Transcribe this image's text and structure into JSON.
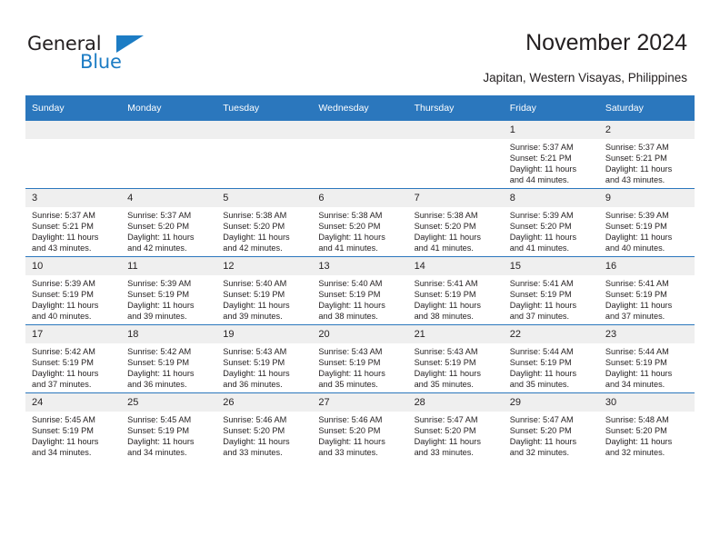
{
  "logo": {
    "word_one": "General",
    "word_two": "Blue",
    "flag_icon": "blue-triangle-flag"
  },
  "header": {
    "title": "November 2024",
    "subtitle": "Japitan, Western Visayas, Philippines"
  },
  "colors": {
    "header_blue": "#2b77bd",
    "daynum_gray": "#efefef",
    "logo_blue": "#1c7cc4",
    "text": "#231f20"
  },
  "calendar": {
    "weekdays": [
      "Sunday",
      "Monday",
      "Tuesday",
      "Wednesday",
      "Thursday",
      "Friday",
      "Saturday"
    ],
    "weeks": [
      [
        {
          "day": "",
          "sunrise": "",
          "sunset": "",
          "daylight_1": "",
          "daylight_2": "",
          "empty": true
        },
        {
          "day": "",
          "sunrise": "",
          "sunset": "",
          "daylight_1": "",
          "daylight_2": "",
          "empty": true
        },
        {
          "day": "",
          "sunrise": "",
          "sunset": "",
          "daylight_1": "",
          "daylight_2": "",
          "empty": true
        },
        {
          "day": "",
          "sunrise": "",
          "sunset": "",
          "daylight_1": "",
          "daylight_2": "",
          "empty": true
        },
        {
          "day": "",
          "sunrise": "",
          "sunset": "",
          "daylight_1": "",
          "daylight_2": "",
          "empty": true
        },
        {
          "day": "1",
          "sunrise": "Sunrise: 5:37 AM",
          "sunset": "Sunset: 5:21 PM",
          "daylight_1": "Daylight: 11 hours",
          "daylight_2": "and 44 minutes.",
          "empty": false
        },
        {
          "day": "2",
          "sunrise": "Sunrise: 5:37 AM",
          "sunset": "Sunset: 5:21 PM",
          "daylight_1": "Daylight: 11 hours",
          "daylight_2": "and 43 minutes.",
          "empty": false
        }
      ],
      [
        {
          "day": "3",
          "sunrise": "Sunrise: 5:37 AM",
          "sunset": "Sunset: 5:21 PM",
          "daylight_1": "Daylight: 11 hours",
          "daylight_2": "and 43 minutes.",
          "empty": false
        },
        {
          "day": "4",
          "sunrise": "Sunrise: 5:37 AM",
          "sunset": "Sunset: 5:20 PM",
          "daylight_1": "Daylight: 11 hours",
          "daylight_2": "and 42 minutes.",
          "empty": false
        },
        {
          "day": "5",
          "sunrise": "Sunrise: 5:38 AM",
          "sunset": "Sunset: 5:20 PM",
          "daylight_1": "Daylight: 11 hours",
          "daylight_2": "and 42 minutes.",
          "empty": false
        },
        {
          "day": "6",
          "sunrise": "Sunrise: 5:38 AM",
          "sunset": "Sunset: 5:20 PM",
          "daylight_1": "Daylight: 11 hours",
          "daylight_2": "and 41 minutes.",
          "empty": false
        },
        {
          "day": "7",
          "sunrise": "Sunrise: 5:38 AM",
          "sunset": "Sunset: 5:20 PM",
          "daylight_1": "Daylight: 11 hours",
          "daylight_2": "and 41 minutes.",
          "empty": false
        },
        {
          "day": "8",
          "sunrise": "Sunrise: 5:39 AM",
          "sunset": "Sunset: 5:20 PM",
          "daylight_1": "Daylight: 11 hours",
          "daylight_2": "and 41 minutes.",
          "empty": false
        },
        {
          "day": "9",
          "sunrise": "Sunrise: 5:39 AM",
          "sunset": "Sunset: 5:19 PM",
          "daylight_1": "Daylight: 11 hours",
          "daylight_2": "and 40 minutes.",
          "empty": false
        }
      ],
      [
        {
          "day": "10",
          "sunrise": "Sunrise: 5:39 AM",
          "sunset": "Sunset: 5:19 PM",
          "daylight_1": "Daylight: 11 hours",
          "daylight_2": "and 40 minutes.",
          "empty": false
        },
        {
          "day": "11",
          "sunrise": "Sunrise: 5:39 AM",
          "sunset": "Sunset: 5:19 PM",
          "daylight_1": "Daylight: 11 hours",
          "daylight_2": "and 39 minutes.",
          "empty": false
        },
        {
          "day": "12",
          "sunrise": "Sunrise: 5:40 AM",
          "sunset": "Sunset: 5:19 PM",
          "daylight_1": "Daylight: 11 hours",
          "daylight_2": "and 39 minutes.",
          "empty": false
        },
        {
          "day": "13",
          "sunrise": "Sunrise: 5:40 AM",
          "sunset": "Sunset: 5:19 PM",
          "daylight_1": "Daylight: 11 hours",
          "daylight_2": "and 38 minutes.",
          "empty": false
        },
        {
          "day": "14",
          "sunrise": "Sunrise: 5:41 AM",
          "sunset": "Sunset: 5:19 PM",
          "daylight_1": "Daylight: 11 hours",
          "daylight_2": "and 38 minutes.",
          "empty": false
        },
        {
          "day": "15",
          "sunrise": "Sunrise: 5:41 AM",
          "sunset": "Sunset: 5:19 PM",
          "daylight_1": "Daylight: 11 hours",
          "daylight_2": "and 37 minutes.",
          "empty": false
        },
        {
          "day": "16",
          "sunrise": "Sunrise: 5:41 AM",
          "sunset": "Sunset: 5:19 PM",
          "daylight_1": "Daylight: 11 hours",
          "daylight_2": "and 37 minutes.",
          "empty": false
        }
      ],
      [
        {
          "day": "17",
          "sunrise": "Sunrise: 5:42 AM",
          "sunset": "Sunset: 5:19 PM",
          "daylight_1": "Daylight: 11 hours",
          "daylight_2": "and 37 minutes.",
          "empty": false
        },
        {
          "day": "18",
          "sunrise": "Sunrise: 5:42 AM",
          "sunset": "Sunset: 5:19 PM",
          "daylight_1": "Daylight: 11 hours",
          "daylight_2": "and 36 minutes.",
          "empty": false
        },
        {
          "day": "19",
          "sunrise": "Sunrise: 5:43 AM",
          "sunset": "Sunset: 5:19 PM",
          "daylight_1": "Daylight: 11 hours",
          "daylight_2": "and 36 minutes.",
          "empty": false
        },
        {
          "day": "20",
          "sunrise": "Sunrise: 5:43 AM",
          "sunset": "Sunset: 5:19 PM",
          "daylight_1": "Daylight: 11 hours",
          "daylight_2": "and 35 minutes.",
          "empty": false
        },
        {
          "day": "21",
          "sunrise": "Sunrise: 5:43 AM",
          "sunset": "Sunset: 5:19 PM",
          "daylight_1": "Daylight: 11 hours",
          "daylight_2": "and 35 minutes.",
          "empty": false
        },
        {
          "day": "22",
          "sunrise": "Sunrise: 5:44 AM",
          "sunset": "Sunset: 5:19 PM",
          "daylight_1": "Daylight: 11 hours",
          "daylight_2": "and 35 minutes.",
          "empty": false
        },
        {
          "day": "23",
          "sunrise": "Sunrise: 5:44 AM",
          "sunset": "Sunset: 5:19 PM",
          "daylight_1": "Daylight: 11 hours",
          "daylight_2": "and 34 minutes.",
          "empty": false
        }
      ],
      [
        {
          "day": "24",
          "sunrise": "Sunrise: 5:45 AM",
          "sunset": "Sunset: 5:19 PM",
          "daylight_1": "Daylight: 11 hours",
          "daylight_2": "and 34 minutes.",
          "empty": false
        },
        {
          "day": "25",
          "sunrise": "Sunrise: 5:45 AM",
          "sunset": "Sunset: 5:19 PM",
          "daylight_1": "Daylight: 11 hours",
          "daylight_2": "and 34 minutes.",
          "empty": false
        },
        {
          "day": "26",
          "sunrise": "Sunrise: 5:46 AM",
          "sunset": "Sunset: 5:20 PM",
          "daylight_1": "Daylight: 11 hours",
          "daylight_2": "and 33 minutes.",
          "empty": false
        },
        {
          "day": "27",
          "sunrise": "Sunrise: 5:46 AM",
          "sunset": "Sunset: 5:20 PM",
          "daylight_1": "Daylight: 11 hours",
          "daylight_2": "and 33 minutes.",
          "empty": false
        },
        {
          "day": "28",
          "sunrise": "Sunrise: 5:47 AM",
          "sunset": "Sunset: 5:20 PM",
          "daylight_1": "Daylight: 11 hours",
          "daylight_2": "and 33 minutes.",
          "empty": false
        },
        {
          "day": "29",
          "sunrise": "Sunrise: 5:47 AM",
          "sunset": "Sunset: 5:20 PM",
          "daylight_1": "Daylight: 11 hours",
          "daylight_2": "and 32 minutes.",
          "empty": false
        },
        {
          "day": "30",
          "sunrise": "Sunrise: 5:48 AM",
          "sunset": "Sunset: 5:20 PM",
          "daylight_1": "Daylight: 11 hours",
          "daylight_2": "and 32 minutes.",
          "empty": false
        }
      ]
    ]
  }
}
